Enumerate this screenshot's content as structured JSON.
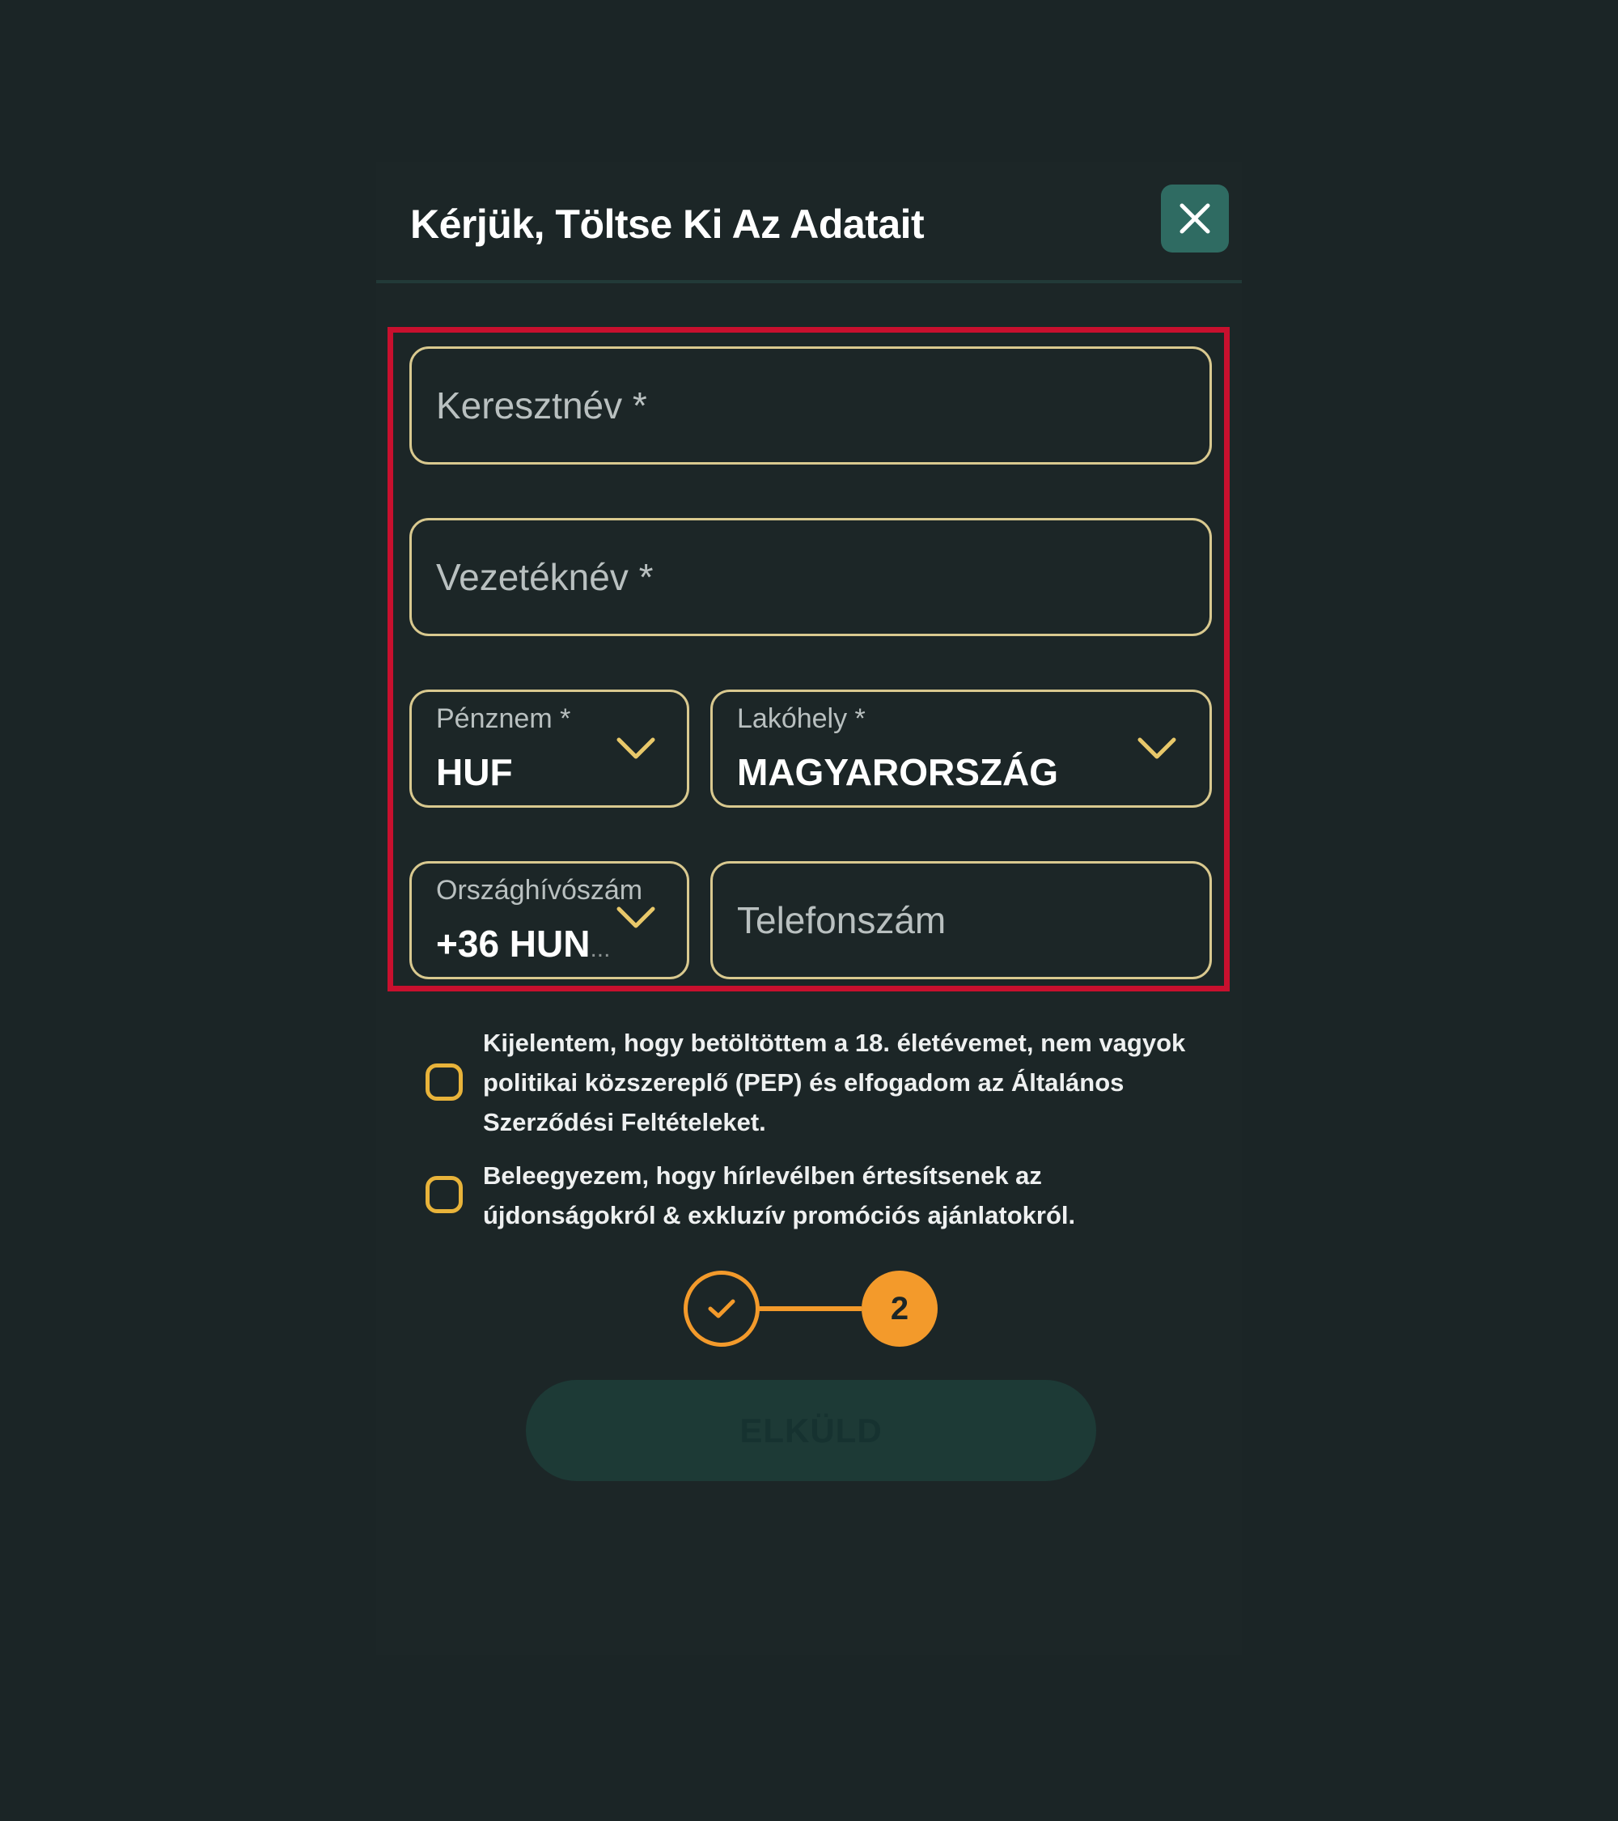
{
  "modal": {
    "title": "Kérjük, Töltse Ki Az Adatait",
    "close_icon": "close-icon"
  },
  "form": {
    "first_name": {
      "placeholder": "Keresztnév *"
    },
    "last_name": {
      "placeholder": "Vezetéknév *"
    },
    "currency": {
      "label": "Pénznem *",
      "value": "HUF"
    },
    "residence": {
      "label": "Lakóhely *",
      "value": "MAGYARORSZÁG"
    },
    "country_code": {
      "label": "Országhívószám",
      "value": "+36 HUN",
      "ellipsis": "..."
    },
    "phone": {
      "placeholder": "Telefonszám"
    }
  },
  "consents": [
    {
      "text": "Kijelentem, hogy betöltöttem a 18. életévemet, nem vagyok politikai közszereplő (PEP) és elfogadom az Általános Szerződési Feltételeket."
    },
    {
      "text": "Beleegyezem, hogy hírlevélben értesítsenek az újdonságokról & exkluzív promóciós ajánlatokról."
    }
  ],
  "stepper": {
    "step1_icon": "check-icon",
    "step2_label": "2"
  },
  "submit": {
    "label": "ELKÜLD"
  },
  "colors": {
    "background": "#1b2526",
    "field_border": "#d9c98f",
    "highlight": "#c8102e",
    "accent_orange": "#f39a2b",
    "checkbox_border": "#e8b33a",
    "close_button_bg": "#2f6b62",
    "submit_bg": "#1d3a36"
  }
}
